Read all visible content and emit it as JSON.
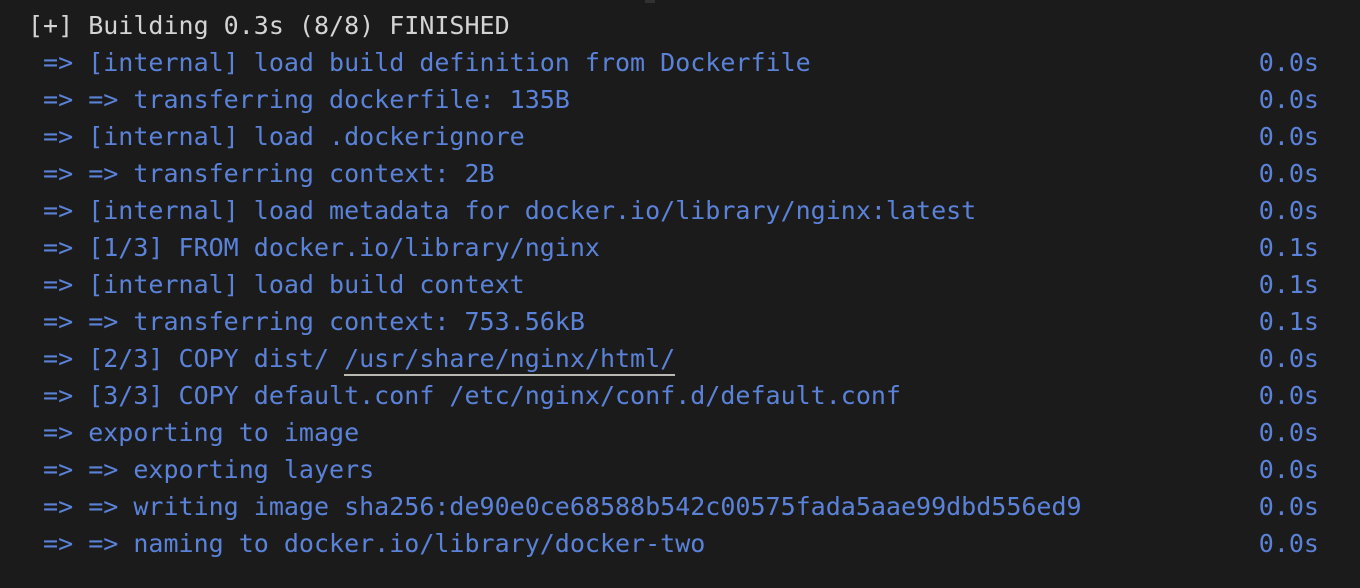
{
  "terminal": {
    "background_color": "#1b1b1b",
    "summary_text_color": "#d4d4d4",
    "step_text_color": "#5b82d9",
    "link_underline_color": "#b9b9b2",
    "header": {
      "text": "[+] Building 0.3s (8/8) FINISHED",
      "status": "FINISHED",
      "elapsed": "0.3s",
      "steps_completed": "8/8"
    },
    "lines": [
      {
        "kind": "summary",
        "text": "[+] Building 0.3s (8/8) FINISHED",
        "time": ""
      },
      {
        "kind": "step",
        "text": " => [internal] load build definition from Dockerfile",
        "time": "0.0s"
      },
      {
        "kind": "step",
        "text": " => => transferring dockerfile: 135B",
        "time": "0.0s"
      },
      {
        "kind": "step",
        "text": " => [internal] load .dockerignore",
        "time": "0.0s"
      },
      {
        "kind": "step",
        "text": " => => transferring context: 2B",
        "time": "0.0s"
      },
      {
        "kind": "step",
        "text": " => [internal] load metadata for docker.io/library/nginx:latest",
        "time": "0.0s"
      },
      {
        "kind": "step",
        "text": " => [1/3] FROM docker.io/library/nginx",
        "time": "0.1s"
      },
      {
        "kind": "step",
        "text": " => [internal] load build context",
        "time": "0.1s"
      },
      {
        "kind": "step",
        "text": " => => transferring context: 753.56kB",
        "time": "0.1s"
      },
      {
        "kind": "step",
        "text": " => [2/3] COPY dist/ ",
        "link": "/usr/share/nginx/html/",
        "time": "0.0s"
      },
      {
        "kind": "step",
        "text": " => [3/3] COPY default.conf /etc/nginx/conf.d/default.conf",
        "time": "0.0s"
      },
      {
        "kind": "step",
        "text": " => exporting to image",
        "time": "0.0s"
      },
      {
        "kind": "step",
        "text": " => => exporting layers",
        "time": "0.0s"
      },
      {
        "kind": "step",
        "text": " => => writing image sha256:de90e0ce68588b542c00575fada5aae99dbd556ed9",
        "time": "0.0s"
      },
      {
        "kind": "step",
        "text": " => => naming to docker.io/library/docker-two",
        "time": "0.0s"
      }
    ]
  }
}
